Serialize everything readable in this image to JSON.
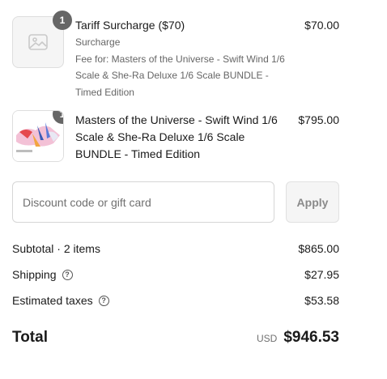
{
  "items": [
    {
      "quantity": "1",
      "name": "Tariff Surcharge ($70)",
      "subtitle": "Surcharge",
      "note": "Fee for: Masters of the Universe - Swift Wind 1/6 Scale & She-Ra Deluxe 1/6 Scale BUNDLE - Timed Edition",
      "price": "$70.00",
      "thumbnail_icon": "image-placeholder-icon"
    },
    {
      "quantity": "1",
      "name": "Masters of the Universe - Swift Wind 1/6 Scale & She-Ra Deluxe 1/6 Scale BUNDLE - Timed Edition",
      "price": "$795.00",
      "thumbnail_icon": "product-thumbnail"
    }
  ],
  "discount": {
    "placeholder": "Discount code or gift card",
    "value": "",
    "apply_label": "Apply"
  },
  "summary": {
    "subtotal_label": "Subtotal · 2 items",
    "subtotal_value": "$865.00",
    "shipping_label": "Shipping",
    "shipping_value": "$27.95",
    "taxes_label": "Estimated taxes",
    "taxes_value": "$53.58",
    "help_icon": "question-circle-icon"
  },
  "total": {
    "label": "Total",
    "currency": "USD",
    "amount": "$946.53"
  },
  "colors": {
    "badge": "#666666",
    "muted_text": "#666666",
    "border": "#d6d6d6",
    "apply_button_bg": "#f5f5f5"
  }
}
